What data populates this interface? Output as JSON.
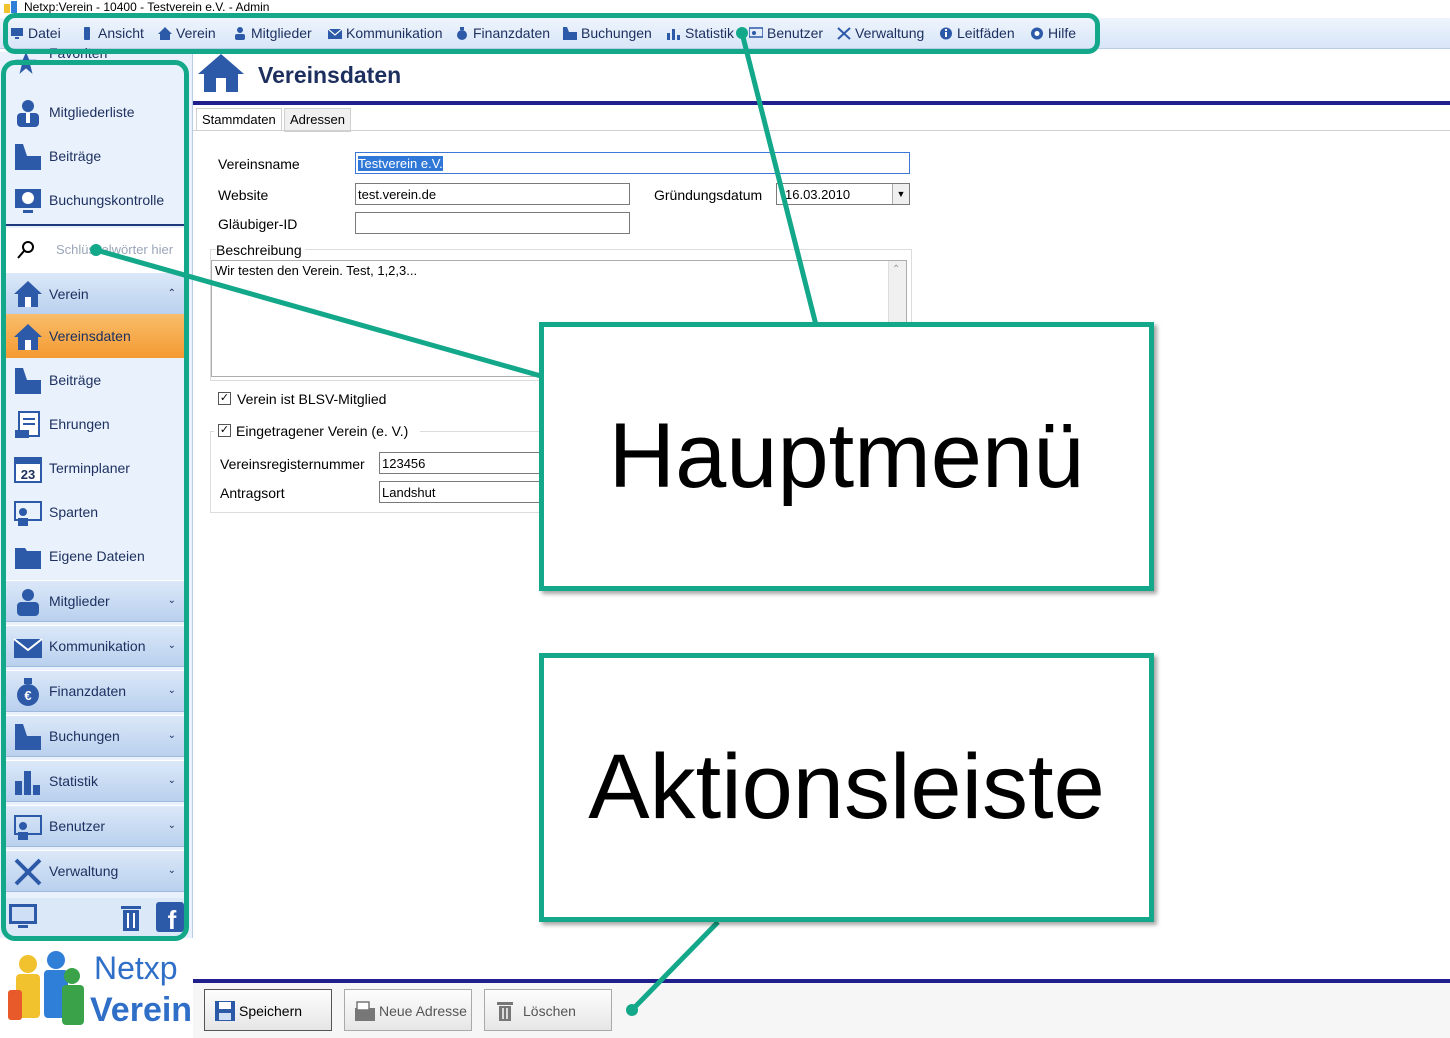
{
  "window": {
    "title": "Netxp:Verein - 10400 - Testverein e.V. - Admin"
  },
  "menu": [
    {
      "label": "Datei",
      "icon": "monitor-icon"
    },
    {
      "label": "Ansicht",
      "icon": "phone-icon"
    },
    {
      "label": "Verein",
      "icon": "home-icon"
    },
    {
      "label": "Mitglieder",
      "icon": "person-icon"
    },
    {
      "label": "Kommunikation",
      "icon": "envelope-icon"
    },
    {
      "label": "Finanzdaten",
      "icon": "money-bag-icon"
    },
    {
      "label": "Buchungen",
      "icon": "cash-register-icon"
    },
    {
      "label": "Statistik",
      "icon": "bar-chart-icon"
    },
    {
      "label": "Benutzer",
      "icon": "users-icon"
    },
    {
      "label": "Verwaltung",
      "icon": "tools-icon"
    },
    {
      "label": "Leitfäden",
      "icon": "info-icon"
    },
    {
      "label": "Hilfe",
      "icon": "help-icon"
    }
  ],
  "sidebar": {
    "favorites_label": "Favoriten",
    "favorites": [
      {
        "label": "Mitgliederliste",
        "icon": "member-list-icon"
      },
      {
        "label": "Beiträge",
        "icon": "cash-register-icon"
      },
      {
        "label": "Buchungskontrolle",
        "icon": "booking-check-icon"
      }
    ],
    "search_placeholder": "Schlüsselwörter hier",
    "verein_section": {
      "label": "Verein",
      "icon": "home-icon"
    },
    "verein_items": [
      {
        "label": "Vereinsdaten",
        "icon": "home-icon",
        "active": true
      },
      {
        "label": "Beiträge",
        "icon": "cash-register-icon"
      },
      {
        "label": "Ehrungen",
        "icon": "certificate-icon"
      },
      {
        "label": "Terminplaner",
        "icon": "calendar-icon",
        "calendar_day": "23"
      },
      {
        "label": "Sparten",
        "icon": "presentation-icon"
      },
      {
        "label": "Eigene Dateien",
        "icon": "folder-icon"
      }
    ],
    "sections": [
      {
        "label": "Mitglieder",
        "icon": "person-icon"
      },
      {
        "label": "Kommunikation",
        "icon": "envelope-icon"
      },
      {
        "label": "Finanzdaten",
        "icon": "money-bag-icon"
      },
      {
        "label": "Buchungen",
        "icon": "cash-register-icon"
      },
      {
        "label": "Statistik",
        "icon": "bar-chart-icon"
      },
      {
        "label": "Benutzer",
        "icon": "users-icon"
      },
      {
        "label": "Verwaltung",
        "icon": "tools-icon"
      }
    ],
    "logo_line1": "Netxp",
    "logo_line2": "Verein"
  },
  "content": {
    "title": "Vereinsdaten",
    "tabs": [
      "Stammdaten",
      "Adressen"
    ],
    "fields": {
      "vereinsname_label": "Vereinsname",
      "vereinsname_value": "Testverein e.V.",
      "website_label": "Website",
      "website_value": "test.verein.de",
      "gruendung_label": "Gründungsdatum",
      "gruendung_value": "16.03.2010",
      "glaeubiger_label": "Gläubiger-ID",
      "glaeubiger_value": "",
      "beschreibung_label": "Beschreibung",
      "beschreibung_value": "Wir testen den Verein. Test, 1,2,3...",
      "blsv_label": "Verein ist BLSV-Mitglied",
      "blsv_checked": true,
      "ev_label": "Eingetragener Verein (e. V.)",
      "ev_checked": true,
      "registernummer_label": "Vereinsregisternummer",
      "registernummer_value": "123456",
      "antragsort_label": "Antragsort",
      "antragsort_value": "Landshut"
    }
  },
  "actions": [
    {
      "label": "Speichern",
      "icon": "floppy-disk-icon"
    },
    {
      "label": "Neue Adresse",
      "icon": "new-address-icon"
    },
    {
      "label": "Löschen",
      "icon": "trash-icon"
    }
  ],
  "callouts": {
    "main_menu": "Hauptmenü",
    "action_bar": "Aktionsleiste"
  },
  "colors": {
    "accent": "#14a88a",
    "navy": "#1c2f5e",
    "active": "#f49a32"
  }
}
